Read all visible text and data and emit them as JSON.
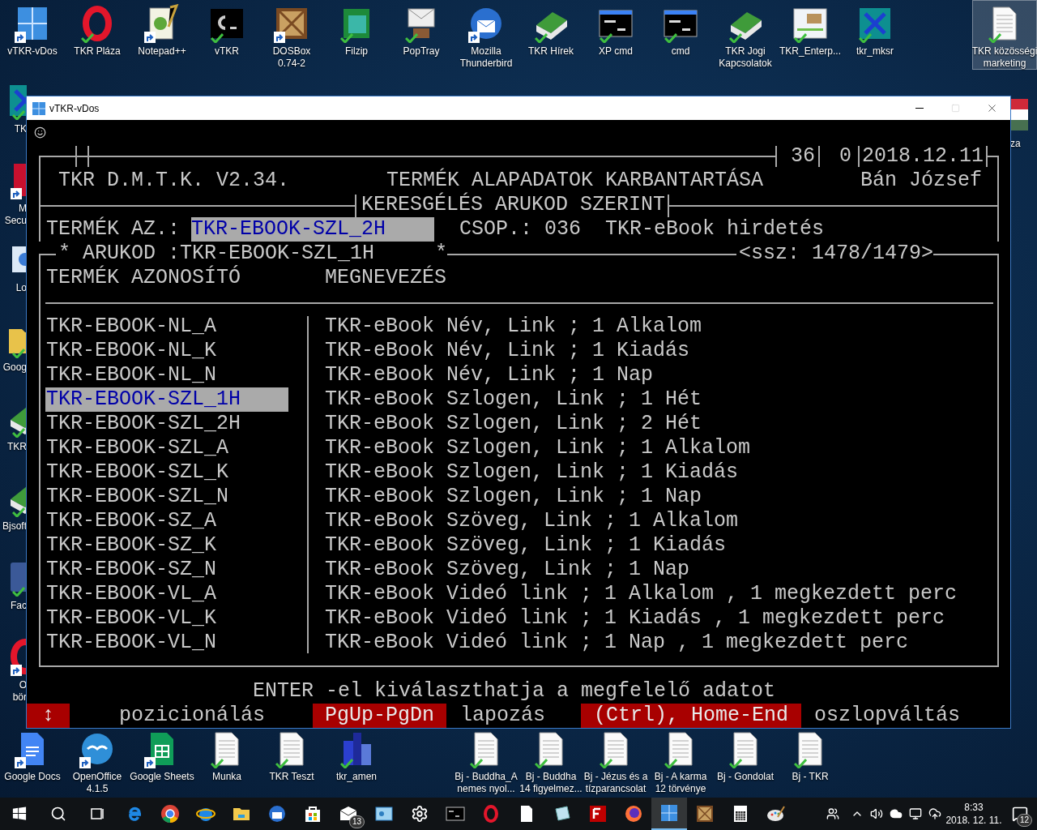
{
  "desktop": {
    "top_icons": [
      {
        "lines": [
          "vTKR-vDos"
        ],
        "kind": "dos",
        "check": false,
        "shortcut": true,
        "selected": false
      },
      {
        "lines": [
          "TKR Pláza"
        ],
        "kind": "opera",
        "check": true,
        "shortcut": false,
        "selected": false
      },
      {
        "lines": [
          "Notepad++"
        ],
        "kind": "notepad",
        "check": false,
        "shortcut": true,
        "selected": false
      },
      {
        "lines": [
          "vTKR"
        ],
        "kind": "terminal",
        "check": true,
        "shortcut": false,
        "selected": false
      },
      {
        "lines": [
          "DOSBox",
          "0.74-2"
        ],
        "kind": "dosbox",
        "check": false,
        "shortcut": true,
        "selected": false
      },
      {
        "lines": [
          "Filzip"
        ],
        "kind": "archive",
        "check": true,
        "shortcut": false,
        "selected": false
      },
      {
        "lines": [
          "PopTray"
        ],
        "kind": "mail",
        "check": true,
        "shortcut": false,
        "selected": false
      },
      {
        "lines": [
          "Mozilla",
          "Thunderbird"
        ],
        "kind": "thunderbird",
        "check": false,
        "shortcut": true,
        "selected": false
      },
      {
        "lines": [
          "TKR Hírek"
        ],
        "kind": "book",
        "check": true,
        "shortcut": false,
        "selected": false
      },
      {
        "lines": [
          "XP cmd"
        ],
        "kind": "cmdwin",
        "check": true,
        "shortcut": false,
        "selected": false
      },
      {
        "lines": [
          "cmd"
        ],
        "kind": "cmdwin",
        "check": true,
        "shortcut": false,
        "selected": false
      },
      {
        "lines": [
          "TKR Jogi",
          "Kapcsolatok"
        ],
        "kind": "book",
        "check": true,
        "shortcut": false,
        "selected": false
      },
      {
        "lines": [
          "TKR_Enterp..."
        ],
        "kind": "screenshot",
        "check": true,
        "shortcut": false,
        "selected": false
      },
      {
        "lines": [
          "tkr_mksr"
        ],
        "kind": "tkr",
        "check": true,
        "shortcut": false,
        "selected": false
      }
    ],
    "top_right_icons": [
      {
        "lines": [
          "TKR közösségi",
          "marketing"
        ],
        "kind": "document",
        "check": true,
        "shortcut": false,
        "selected": true
      }
    ],
    "left_icons": [
      {
        "lines": [
          "TK"
        ],
        "kind": "tkr",
        "check": true,
        "shortcut": false
      },
      {
        "lines": [
          "M",
          "Secu"
        ],
        "kind": "security",
        "check": false,
        "shortcut": true
      },
      {
        "lines": [
          "Lo"
        ],
        "kind": "photo",
        "check": false,
        "shortcut": false
      },
      {
        "lines": [
          "Goog"
        ],
        "kind": "folder",
        "check": true,
        "shortcut": false
      },
      {
        "lines": [
          "TKR"
        ],
        "kind": "book",
        "check": true,
        "shortcut": false
      },
      {
        "lines": [
          "Bjsoft"
        ],
        "kind": "book",
        "check": true,
        "shortcut": false
      },
      {
        "lines": [
          "Fac"
        ],
        "kind": "facebook",
        "check": true,
        "shortcut": false
      },
      {
        "lines": [
          "O",
          "bör"
        ],
        "kind": "opera",
        "check": false,
        "shortcut": true
      }
    ],
    "right_icons": [
      {
        "lines": [
          "za"
        ],
        "kind": "flag",
        "check": false,
        "shortcut": false
      }
    ],
    "bottom_groups": [
      [
        {
          "lines": [
            "Google Docs"
          ],
          "kind": "gdocs",
          "check": false,
          "shortcut": true
        },
        {
          "lines": [
            "OpenOffice",
            "4.1.5"
          ],
          "kind": "openoffice",
          "check": false,
          "shortcut": true
        },
        {
          "lines": [
            "Google Sheets"
          ],
          "kind": "gsheets",
          "check": false,
          "shortcut": true
        },
        {
          "lines": [
            "Munka"
          ],
          "kind": "document",
          "check": true,
          "shortcut": false
        },
        {
          "lines": [
            "TKR Teszt"
          ],
          "kind": "document",
          "check": true,
          "shortcut": false
        },
        {
          "lines": [
            "tkr_amen"
          ],
          "kind": "city",
          "check": true,
          "shortcut": false
        }
      ],
      [
        {
          "lines": [
            "Bj - Buddha_A",
            "nemes nyol..."
          ],
          "kind": "document",
          "check": true,
          "shortcut": false
        },
        {
          "lines": [
            "Bj - Buddha",
            "14 figyelmez..."
          ],
          "kind": "document",
          "check": true,
          "shortcut": false
        },
        {
          "lines": [
            "Bj - Jézus és a",
            "tízparancsolat"
          ],
          "kind": "document",
          "check": true,
          "shortcut": false
        },
        {
          "lines": [
            "Bj - A karma",
            "12 törvénye"
          ],
          "kind": "document",
          "check": true,
          "shortcut": false
        },
        {
          "lines": [
            "Bj - Gondolat"
          ],
          "kind": "document",
          "check": true,
          "shortcut": false
        },
        {
          "lines": [
            "Bj - TKR"
          ],
          "kind": "document",
          "check": true,
          "shortcut": false
        }
      ]
    ]
  },
  "window": {
    "title": "vTKR-vDos",
    "header": {
      "counter_1": "36",
      "counter_2": "0",
      "date": "2018.12.11",
      "app": "TKR D.M.T.K. V2.34.",
      "title": "TERMÉK ALAPADATOK KARBANTARTÁSA",
      "user": "Bán József",
      "mode": "KERESGÉLÉS ARUKOD SZERINT"
    },
    "search": {
      "label": "TERMÉK AZ.:",
      "value": "TKR-EBOOK-SZL_2H",
      "group_label": "CSOP.:",
      "group_code": "036",
      "group_name": "TKR-eBook hirdetés"
    },
    "list": {
      "marker_left": "*",
      "current": "ARUKOD :TKR-EBOOK-SZL_1H",
      "marker_right": "*",
      "position": "<ssz: 1478/1479>",
      "columns": [
        "TERMÉK AZONOSÍTÓ",
        "MEGNEVEZÉS"
      ],
      "rows": [
        {
          "code": "TKR-EBOOK-NL_A",
          "name": "TKR-eBook Név, Link ; 1 Alkalom",
          "selected": false
        },
        {
          "code": "TKR-EBOOK-NL_K",
          "name": "TKR-eBook Név, Link ; 1 Kiadás",
          "selected": false
        },
        {
          "code": "TKR-EBOOK-NL_N",
          "name": "TKR-eBook Név, Link ; 1 Nap",
          "selected": false
        },
        {
          "code": "TKR-EBOOK-SZL_1H",
          "name": "TKR-eBook Szlogen, Link ; 1 Hét",
          "selected": true
        },
        {
          "code": "TKR-EBOOK-SZL_2H",
          "name": "TKR-eBook Szlogen, Link ; 2 Hét",
          "selected": false
        },
        {
          "code": "TKR-EBOOK-SZL_A",
          "name": "TKR-eBook Szlogen, Link ; 1 Alkalom",
          "selected": false
        },
        {
          "code": "TKR-EBOOK-SZL_K",
          "name": "TKR-eBook Szlogen, Link ; 1 Kiadás",
          "selected": false
        },
        {
          "code": "TKR-EBOOK-SZL_N",
          "name": "TKR-eBook Szlogen, Link ; 1 Nap",
          "selected": false
        },
        {
          "code": "TKR-EBOOK-SZ_A",
          "name": "TKR-eBook Szöveg, Link ; 1 Alkalom",
          "selected": false
        },
        {
          "code": "TKR-EBOOK-SZ_K",
          "name": "TKR-eBook Szöveg, Link ; 1 Kiadás",
          "selected": false
        },
        {
          "code": "TKR-EBOOK-SZ_N",
          "name": "TKR-eBook Szöveg, Link ; 1 Nap",
          "selected": false
        },
        {
          "code": "TKR-EBOOK-VL_A",
          "name": "TKR-eBook Videó link ; 1 Alkalom , 1 megkezdett perc",
          "selected": false
        },
        {
          "code": "TKR-EBOOK-VL_K",
          "name": "TKR-eBook Videó link ; 1 Kiadás , 1 megkezdett perc",
          "selected": false
        },
        {
          "code": "TKR-EBOOK-VL_N",
          "name": "TKR-eBook Videó link ; 1 Nap , 1 megkezdett perc",
          "selected": false
        }
      ]
    },
    "hint": "ENTER -el kiválaszthatja a megfelelő adatot",
    "keys": [
      {
        "key": "↕",
        "action": "pozicionálás"
      },
      {
        "key": "PgUp-PgDn",
        "action": "lapozás"
      },
      {
        "key": "(Ctrl), Home-End",
        "action": "oszlopváltás"
      }
    ]
  },
  "taskbar": {
    "apps": [
      {
        "kind": "start",
        "selected": false
      },
      {
        "kind": "search",
        "selected": false
      },
      {
        "kind": "taskview",
        "selected": false
      },
      {
        "kind": "edge",
        "selected": false
      },
      {
        "kind": "chrome",
        "selected": false
      },
      {
        "kind": "ie",
        "selected": false
      },
      {
        "kind": "explorer",
        "selected": false
      },
      {
        "kind": "thunderbird",
        "selected": false
      },
      {
        "kind": "store",
        "selected": false
      },
      {
        "kind": "mail",
        "selected": false,
        "badge": "13"
      },
      {
        "kind": "app",
        "selected": false
      },
      {
        "kind": "settings",
        "selected": false
      },
      {
        "kind": "cmd",
        "selected": false
      },
      {
        "kind": "opera",
        "selected": false
      },
      {
        "kind": "file",
        "selected": false
      },
      {
        "kind": "notepad",
        "selected": false
      },
      {
        "kind": "filezilla",
        "selected": false
      },
      {
        "kind": "firefox",
        "selected": false
      },
      {
        "kind": "dos",
        "selected": true
      },
      {
        "kind": "dosbox",
        "selected": false
      },
      {
        "kind": "calculator",
        "selected": false
      },
      {
        "kind": "paint",
        "selected": false
      }
    ],
    "time": "8:33",
    "date": "2018. 12. 11.",
    "notifications": "12"
  }
}
